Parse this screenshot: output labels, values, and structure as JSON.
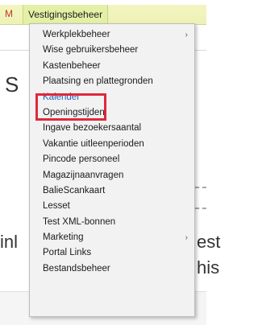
{
  "menubar": {
    "left_fragment": "M",
    "active_menu": "Vestigingsbeheer"
  },
  "background": {
    "left_s": "S",
    "left_inl": "inl",
    "right_est": "est",
    "right_his": "his"
  },
  "dropdown": {
    "items": [
      {
        "label": "Werkplekbeheer",
        "submenu": true
      },
      {
        "label": "Wise gebruikersbeheer",
        "submenu": false
      },
      {
        "label": "Kastenbeheer",
        "submenu": false
      },
      {
        "label": "Plaatsing en plattegronden",
        "submenu": false
      },
      {
        "label": "Kalender",
        "submenu": false
      },
      {
        "label": "Openingstijden",
        "submenu": false
      },
      {
        "label": "Ingave bezoekersaantal",
        "submenu": false
      },
      {
        "label": "Vakantie uitleenperioden",
        "submenu": false
      },
      {
        "label": "Pincode personeel",
        "submenu": false
      },
      {
        "label": "Magazijnaanvragen",
        "submenu": false
      },
      {
        "label": "BalieScankaart",
        "submenu": false
      },
      {
        "label": "Lesset",
        "submenu": false
      },
      {
        "label": "Test XML-bonnen",
        "submenu": false
      },
      {
        "label": "Marketing",
        "submenu": true
      },
      {
        "label": "Portal Links",
        "submenu": false
      },
      {
        "label": "Bestandsbeheer",
        "submenu": false
      }
    ],
    "highlighted_item": "Kalender",
    "highlight_color": "#e0283b",
    "submenu_glyph": "›"
  }
}
